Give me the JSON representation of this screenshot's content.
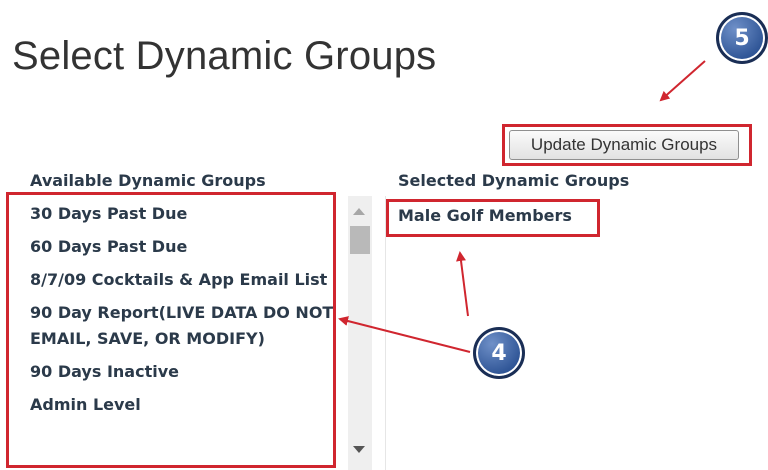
{
  "page": {
    "title": "Select Dynamic Groups"
  },
  "actions": {
    "update_button": "Update Dynamic Groups"
  },
  "available": {
    "header": "Available Dynamic Groups",
    "items": [
      "30 Days Past Due",
      "60 Days Past Due",
      "8/7/09 Cocktails & App Email List",
      "90 Day Report(LIVE DATA DO NOT EMAIL, SAVE, OR MODIFY)",
      "90 Days Inactive",
      "Admin Level"
    ]
  },
  "selected": {
    "header": "Selected Dynamic Groups",
    "items": [
      "Male Golf Members"
    ]
  },
  "annotations": {
    "callout_4": "4",
    "callout_5": "5",
    "highlight_color": "#d0262f",
    "callout_color": "#2f5596"
  }
}
